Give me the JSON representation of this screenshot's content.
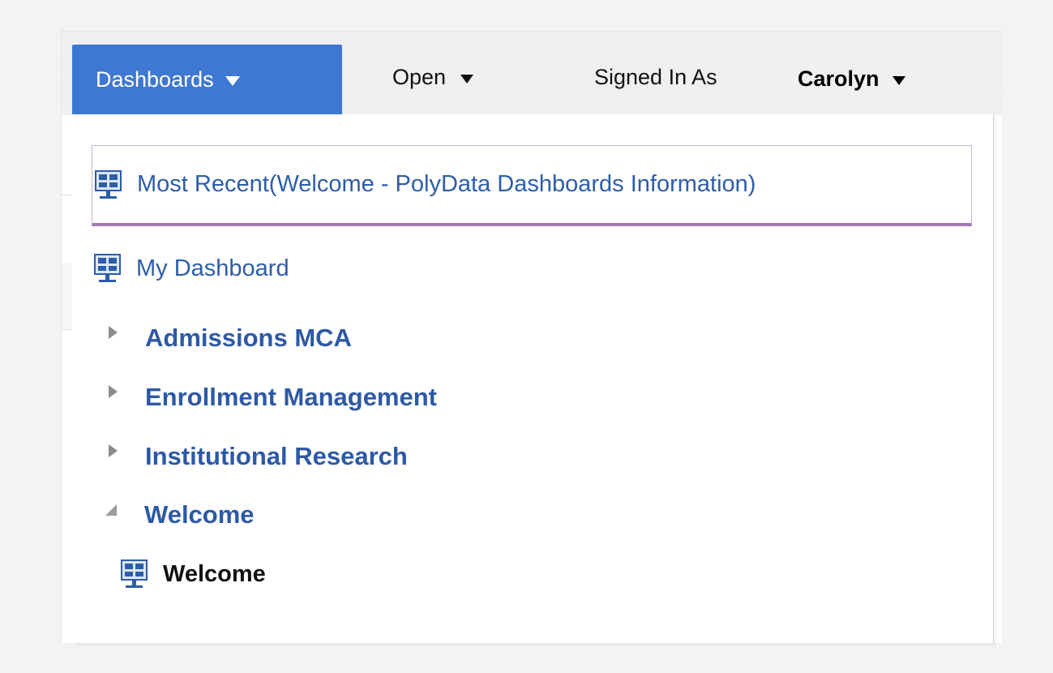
{
  "menubar": {
    "dashboards_label": "Dashboards",
    "open_label": "Open",
    "signed_in_label": "Signed In As",
    "user_name": "Carolyn"
  },
  "dropdown": {
    "most_recent_label": "Most Recent(Welcome - PolyData Dashboards Information)",
    "my_dashboard_label": "My Dashboard",
    "folders": [
      {
        "label": "Admissions MCA",
        "expanded": false
      },
      {
        "label": "Enrollment Management",
        "expanded": false
      },
      {
        "label": "Institutional Research",
        "expanded": false
      },
      {
        "label": "Welcome",
        "expanded": true,
        "items": [
          {
            "label": "Welcome"
          }
        ]
      }
    ]
  },
  "colors": {
    "accent": "#3e78d2",
    "link": "#2e5da8",
    "highlight_border": "#a07ab1",
    "background": "#f3f3f3"
  },
  "icons": {
    "dashboard": "dashboard-monitor-icon",
    "collapsed": "triangle-right-icon",
    "expanded": "triangle-down-right-icon",
    "menu": "caret-down-icon"
  }
}
